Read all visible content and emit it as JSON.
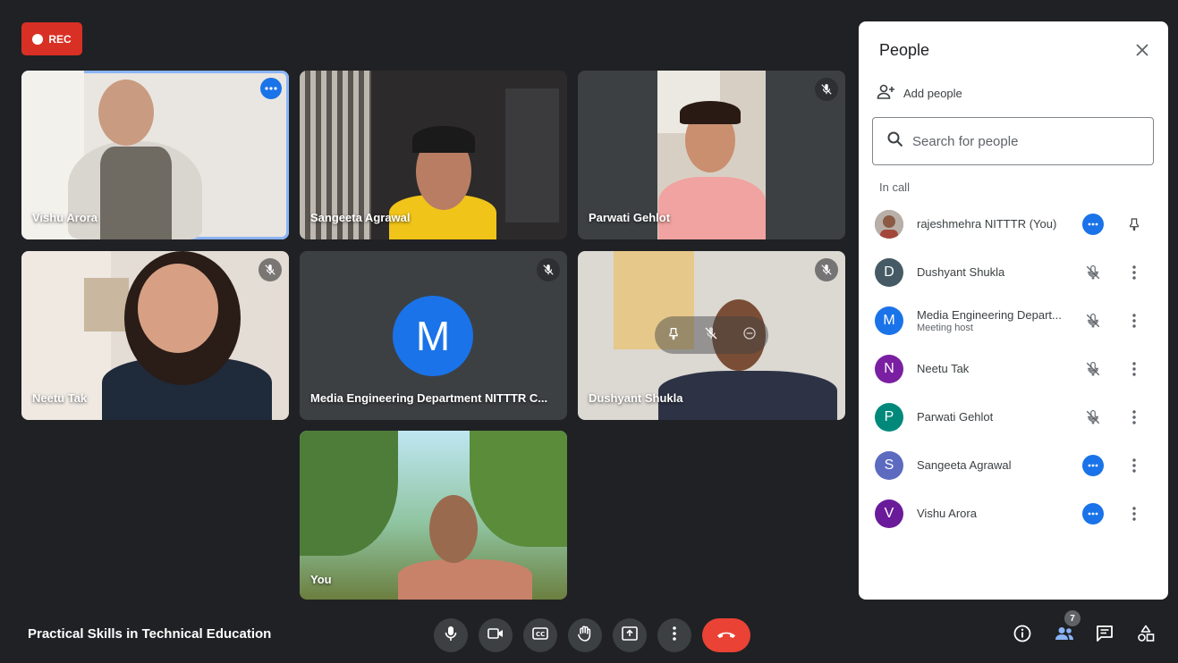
{
  "recording": {
    "label": "REC"
  },
  "tiles": [
    {
      "name": "Vishu Arora"
    },
    {
      "name": "Sangeeta Agrawal"
    },
    {
      "name": "Parwati Gehlot"
    },
    {
      "name": "Neetu Tak"
    },
    {
      "name": "Media Engineering Department NITTTR C...",
      "avatar_letter": "M"
    },
    {
      "name": "Dushyant Shukla"
    },
    {
      "name": "You"
    }
  ],
  "panel": {
    "title": "People",
    "add_people": "Add people",
    "search_placeholder": "Search for people",
    "section": "In call",
    "participants": [
      {
        "name": "rajeshmehra NITTTR (You)",
        "avatar": "photo",
        "color": "#6d6d6d"
      },
      {
        "name": "Dushyant Shukla",
        "avatar": "D",
        "color": "#455a64"
      },
      {
        "name": "Media Engineering Depart...",
        "subtitle": "Meeting host",
        "avatar": "M",
        "color": "#1a73e8"
      },
      {
        "name": "Neetu Tak",
        "avatar": "N",
        "color": "#7b1fa2"
      },
      {
        "name": "Parwati Gehlot",
        "avatar": "P",
        "color": "#00897b"
      },
      {
        "name": "Sangeeta Agrawal",
        "avatar": "S",
        "color": "#5c6bc0"
      },
      {
        "name": "Vishu Arora",
        "avatar": "V",
        "color": "#6a1b9a"
      }
    ]
  },
  "footer": {
    "meeting_title": "Practical Skills in Technical Education",
    "participant_count": "7"
  },
  "icons": [
    "mic-icon",
    "camera-icon",
    "captions-icon",
    "raise-hand-icon",
    "present-icon",
    "more-vert-icon",
    "hangup-icon",
    "info-icon",
    "people-icon",
    "chat-icon",
    "activities-icon",
    "mic-off-icon",
    "pin-icon",
    "close-icon",
    "search-icon",
    "add-person-icon"
  ],
  "colors": {
    "accent": "#1a73e8",
    "hangup": "#ea4335",
    "rec": "#d93025",
    "background": "#202124"
  }
}
